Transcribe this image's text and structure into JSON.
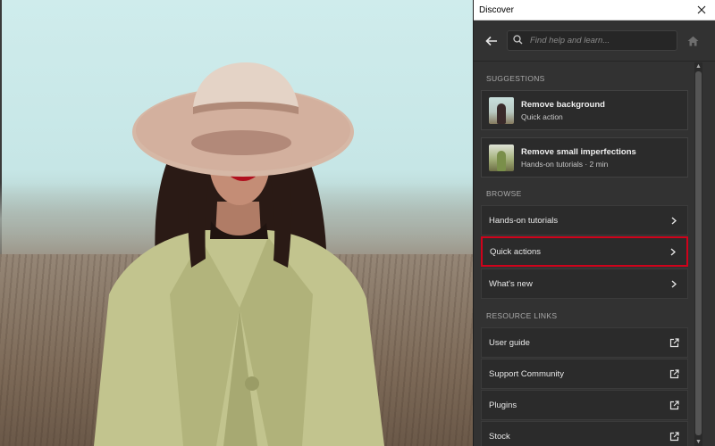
{
  "window": {
    "title": "Discover"
  },
  "search": {
    "placeholder": "Find help and learn..."
  },
  "sections": {
    "suggestions": "SUGGESTIONS",
    "browse": "BROWSE",
    "resources": "RESOURCE LINKS"
  },
  "suggestions": [
    {
      "title": "Remove background",
      "subtitle": "Quick action",
      "icon": "photo-thumbnail"
    },
    {
      "title": "Remove small imperfections",
      "subtitle": "Hands-on tutorials  ·  2 min",
      "icon": "photo-thumbnail"
    }
  ],
  "browse": [
    {
      "label": "Hands-on tutorials",
      "icon": "chevron-right-icon"
    },
    {
      "label": "Quick actions",
      "icon": "chevron-right-icon",
      "selected": true
    },
    {
      "label": "What's new",
      "icon": "chevron-right-icon"
    }
  ],
  "resources": [
    {
      "label": "User guide",
      "icon": "external-link-icon"
    },
    {
      "label": "Support Community",
      "icon": "external-link-icon"
    },
    {
      "label": "Plugins",
      "icon": "external-link-icon"
    },
    {
      "label": "Stock",
      "icon": "external-link-icon"
    }
  ],
  "colors": {
    "panel": "#323232",
    "card": "#2b2b2b",
    "highlight": "#d0021b"
  }
}
